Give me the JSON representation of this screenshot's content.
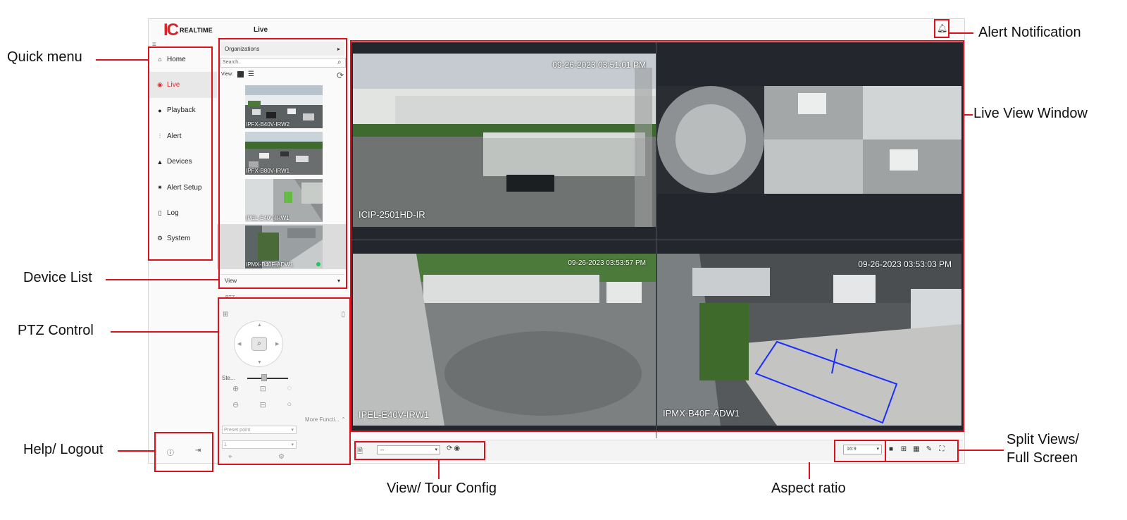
{
  "app": {
    "logo_ic": "IC",
    "logo_text": "REALTIME",
    "page_title": "Live"
  },
  "menu": [
    {
      "label": "Home",
      "icon": "home-icon",
      "glyph": "⌂"
    },
    {
      "label": "Live",
      "icon": "live-icon",
      "glyph": "◉",
      "active": true
    },
    {
      "label": "Playback",
      "icon": "playback-icon",
      "glyph": "●"
    },
    {
      "label": "Alert",
      "icon": "alert-icon",
      "glyph": "⫶"
    },
    {
      "label": "Devices",
      "icon": "devices-icon",
      "glyph": "▲"
    },
    {
      "label": "Alert Setup",
      "icon": "alert-setup-icon",
      "glyph": "✷"
    },
    {
      "label": "Log",
      "icon": "log-icon",
      "glyph": "▯"
    },
    {
      "label": "System",
      "icon": "system-icon",
      "glyph": "⚙"
    }
  ],
  "device_panel": {
    "organizations": "Organizations",
    "search_placeholder": "Search..",
    "view_label": "View:",
    "devices": [
      {
        "name": "IPFX-B40V-IRW2"
      },
      {
        "name": "IPFX-B80V-IRW1"
      },
      {
        "name": "IPEL-E40V-IRW1"
      },
      {
        "name": "IPMX-B40F-ADW1"
      }
    ],
    "view_select": "View"
  },
  "ptz": {
    "title": "PTZ",
    "step_label": "Ste...",
    "more_functions": "More Functi...",
    "preset_point": "Preset point",
    "preset_value": "1"
  },
  "live": {
    "cameras": [
      {
        "label": "ICIP-2501HD-IR",
        "timestamp": "09-26-2023 03:51:01 PM"
      },
      {
        "label": "",
        "timestamp": ""
      },
      {
        "label": "IPEL-E40V-IRW1",
        "timestamp": "09-26-2023 03:53:57 PM"
      },
      {
        "label": "IPMX-B40F-ADW1",
        "timestamp": "09-26-2023 03:53:03 PM"
      }
    ]
  },
  "toolbar": {
    "tour_value": "--",
    "aspect_value": "16:9"
  },
  "callouts": {
    "quick_menu": "Quick menu",
    "device_list": "Device List",
    "ptz_control": "PTZ Control",
    "help_logout": "Help/ Logout",
    "alert_notification": "Alert Notification",
    "live_view_window": "Live View Window",
    "split_views_1": "Split Views/",
    "split_views_2": "Full Screen",
    "view_tour_config": "View/ Tour Config",
    "aspect_ratio": "Aspect ratio"
  },
  "colors": {
    "callout_red": "#e0101a",
    "active_menu": "#e0262b",
    "live_bg": "#23272d"
  }
}
